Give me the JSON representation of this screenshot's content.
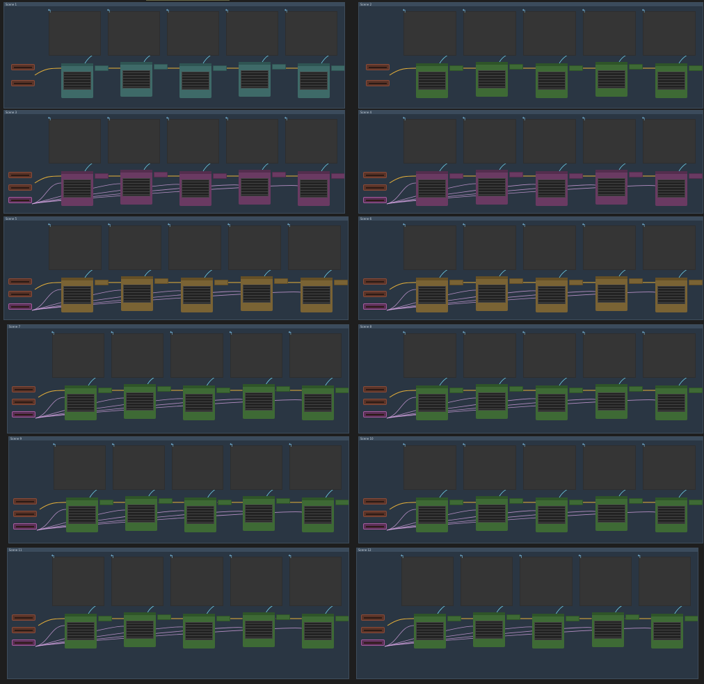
{
  "canvas": {
    "background": "#1e1e1e"
  },
  "groups": [
    {
      "title": "Scene 1",
      "theme": "teal",
      "loaders": [
        "brown",
        "brown"
      ]
    },
    {
      "title": "Scene 2",
      "theme": "green",
      "loaders": [
        "brown",
        "brown"
      ]
    },
    {
      "title": "Scene 3",
      "theme": "purple",
      "loaders": [
        "brown",
        "brown",
        "pink"
      ]
    },
    {
      "title": "Scene 4",
      "theme": "purple",
      "loaders": [
        "brown",
        "brown",
        "pink"
      ]
    },
    {
      "title": "Scene 5",
      "theme": "gold",
      "loaders": [
        "brown",
        "brown",
        "pink"
      ]
    },
    {
      "title": "Scene 6",
      "theme": "gold",
      "loaders": [
        "brown",
        "brown",
        "pink"
      ]
    },
    {
      "title": "Scene 7",
      "theme": "green",
      "loaders": [
        "brown",
        "brown",
        "pink"
      ]
    },
    {
      "title": "Scene 8",
      "theme": "green",
      "loaders": [
        "brown",
        "brown",
        "pink"
      ]
    },
    {
      "title": "Scene 9",
      "theme": "green",
      "loaders": [
        "brown",
        "brown",
        "pink"
      ]
    },
    {
      "title": "Scene 10",
      "theme": "green",
      "loaders": [
        "brown",
        "brown",
        "pink"
      ]
    },
    {
      "title": "Scene 11",
      "theme": "green",
      "loaders": [
        "brown",
        "brown",
        "pink"
      ]
    },
    {
      "title": "Scene 12",
      "theme": "green",
      "loaders": [
        "brown",
        "brown",
        "pink"
      ]
    }
  ],
  "themes": {
    "teal": {
      "body": "#3e6a68",
      "head": "#2f5553"
    },
    "green": {
      "body": "#3e6a35",
      "head": "#2f5529"
    },
    "purple": {
      "body": "#6a3a62",
      "head": "#542d4e"
    },
    "gold": {
      "body": "#7a6334",
      "head": "#644f26"
    }
  },
  "wire_colors": {
    "yellow": "#e8b23a",
    "pink": "#d9a6e6",
    "cyan": "#6fd0e8"
  },
  "preview_count": 5,
  "icons": [
    "arrow-icon"
  ]
}
